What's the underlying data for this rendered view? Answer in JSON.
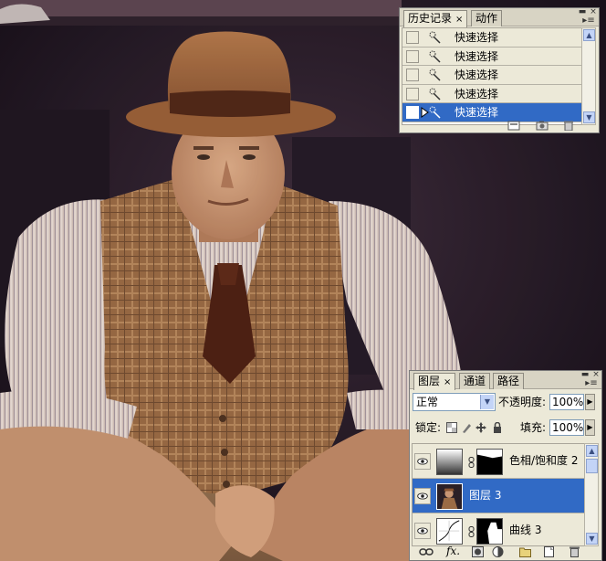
{
  "history_panel": {
    "tabs": [
      {
        "label": "历史记录",
        "active": true
      },
      {
        "label": "动作",
        "active": false
      }
    ],
    "tab_close": "×",
    "menu_glyph": "▸≡",
    "close_glyph": "×",
    "items": [
      {
        "label": "快速选择",
        "selected": false
      },
      {
        "label": "快速选择",
        "selected": false
      },
      {
        "label": "快速选择",
        "selected": false
      },
      {
        "label": "快速选择",
        "selected": false
      },
      {
        "label": "快速选择",
        "selected": true
      }
    ],
    "footer_icons": [
      "new-document-from-state-icon",
      "new-snapshot-icon",
      "trash-icon"
    ]
  },
  "layers_panel": {
    "tabs": [
      {
        "label": "图层",
        "active": true
      },
      {
        "label": "通道",
        "active": false
      },
      {
        "label": "路径",
        "active": false
      }
    ],
    "tab_close": "×",
    "menu_glyph": "▸≡",
    "close_glyph": "×",
    "blend_mode": "正常",
    "opacity_label": "不透明度:",
    "opacity_value": "100%",
    "lock_label": "锁定:",
    "fill_label": "填充:",
    "fill_value": "100%",
    "lock_icons": [
      "lock-transparent-icon",
      "lock-paint-icon",
      "lock-move-icon",
      "lock-all-icon"
    ],
    "layers": [
      {
        "name": "色相/饱和度 2",
        "type": "adjustment-hue",
        "selected": false,
        "has_mask": true
      },
      {
        "name": "图层 3",
        "type": "pixel",
        "selected": true,
        "has_mask": false
      },
      {
        "name": "曲线 3",
        "type": "adjustment-curves",
        "selected": false,
        "has_mask": true
      }
    ],
    "footer_icons": [
      "link-layers-icon",
      "fx-icon",
      "add-mask-icon",
      "adjustment-icon",
      "group-icon",
      "new-layer-icon",
      "trash-icon"
    ],
    "fx_label": "fx."
  },
  "colors": {
    "selection_blue": "#316ac5",
    "panel_bg": "#ece9d8"
  }
}
